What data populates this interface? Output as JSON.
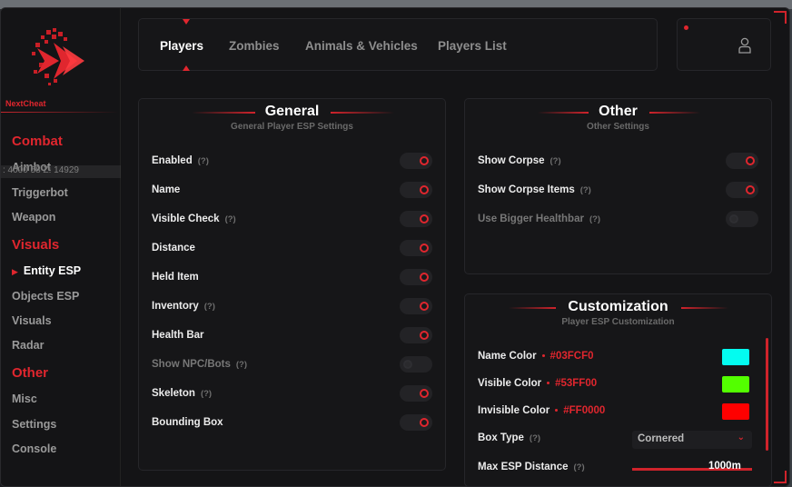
{
  "brand": {
    "name": "NextCheat"
  },
  "coords_overlay": ": 4000 58 Z: 14929",
  "sidebar": {
    "categories": [
      "Combat",
      "Visuals",
      "Other"
    ],
    "items": [
      "Aimbot",
      "Triggerbot",
      "Weapon",
      "Entity ESP",
      "Objects ESP",
      "Visuals",
      "Radar",
      "Misc",
      "Settings",
      "Console"
    ],
    "active_item": "Entity ESP"
  },
  "tabs": [
    {
      "label": "Players",
      "active": true
    },
    {
      "label": "Zombies",
      "active": false
    },
    {
      "label": "Animals & Vehicles",
      "active": false
    },
    {
      "label": "Players List",
      "active": false
    }
  ],
  "general": {
    "title": "General",
    "subtitle": "General Player ESP Settings",
    "help": "(?)",
    "options": [
      {
        "label": "Enabled",
        "help": true,
        "on": true
      },
      {
        "label": "Name",
        "help": false,
        "on": true
      },
      {
        "label": "Visible Check",
        "help": true,
        "on": true
      },
      {
        "label": "Distance",
        "help": false,
        "on": true
      },
      {
        "label": "Held Item",
        "help": false,
        "on": true
      },
      {
        "label": "Inventory",
        "help": true,
        "on": true
      },
      {
        "label": "Health Bar",
        "help": false,
        "on": true
      },
      {
        "label": "Show NPC/Bots",
        "help": true,
        "on": false
      },
      {
        "label": "Skeleton",
        "help": true,
        "on": true
      },
      {
        "label": "Bounding Box",
        "help": false,
        "on": true
      }
    ]
  },
  "other": {
    "title": "Other",
    "subtitle": "Other Settings",
    "options": [
      {
        "label": "Show Corpse",
        "help": true,
        "on": true
      },
      {
        "label": "Show Corpse Items",
        "help": true,
        "on": true
      },
      {
        "label": "Use Bigger Healthbar",
        "help": true,
        "on": false
      }
    ]
  },
  "customization": {
    "title": "Customization",
    "subtitle": "Player ESP Customization",
    "colors": [
      {
        "label": "Name Color",
        "hex": "#03FCF0",
        "swatch": "#03fcf0"
      },
      {
        "label": "Visible Color",
        "hex": "#53FF00",
        "swatch": "#53ff00"
      },
      {
        "label": "Invisible Color",
        "hex": "#FF0000",
        "swatch": "#ff0000"
      }
    ],
    "box_type": {
      "label": "Box Type",
      "value": "Cornered"
    },
    "max_distance": {
      "label": "Max ESP Distance",
      "value": "1000m",
      "fraction": 1.0
    }
  },
  "colors": {
    "accent": "#e0262e",
    "panel": "#161618",
    "background": "#141416"
  }
}
